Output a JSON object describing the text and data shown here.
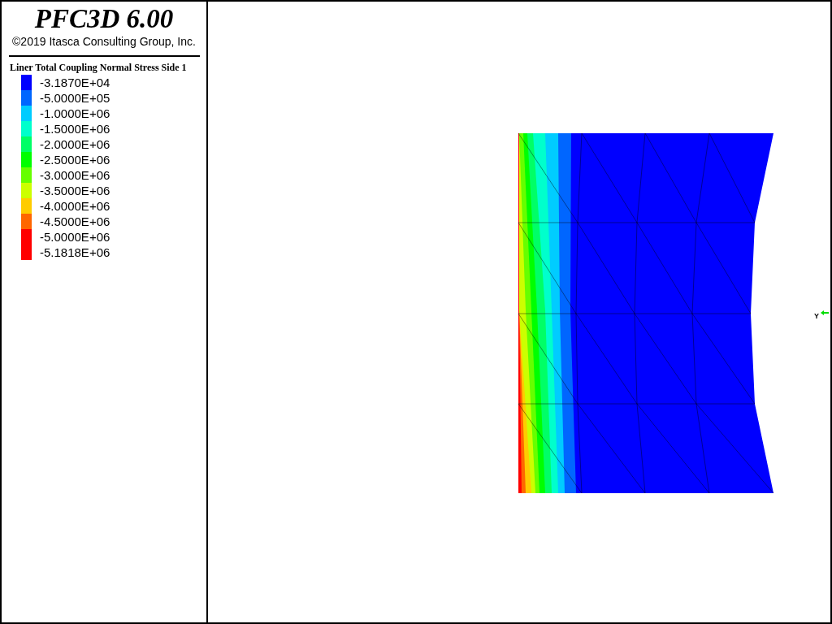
{
  "title": "PFC3D 6.00",
  "copyright": "©2019 Itasca Consulting Group, Inc.",
  "legend": {
    "heading": "Liner Total Coupling Normal Stress Side 1",
    "items": [
      {
        "label": "-3.1870E+04",
        "color": "#0000ff"
      },
      {
        "label": "-5.0000E+05",
        "color": "#0066ff"
      },
      {
        "label": "-1.0000E+06",
        "color": "#00ccff"
      },
      {
        "label": "-1.5000E+06",
        "color": "#00ffcc"
      },
      {
        "label": "-2.0000E+06",
        "color": "#00ff66"
      },
      {
        "label": "-2.5000E+06",
        "color": "#00ff00"
      },
      {
        "label": "-3.0000E+06",
        "color": "#66ff00"
      },
      {
        "label": "-3.5000E+06",
        "color": "#ccff00"
      },
      {
        "label": "-4.0000E+06",
        "color": "#ffcc00"
      },
      {
        "label": "-4.5000E+06",
        "color": "#ff6600"
      },
      {
        "label": "-5.0000E+06",
        "color": "#ff0000"
      },
      {
        "label": "-5.1818E+06",
        "color": "#ff0000"
      }
    ]
  },
  "axis_label": "Y"
}
